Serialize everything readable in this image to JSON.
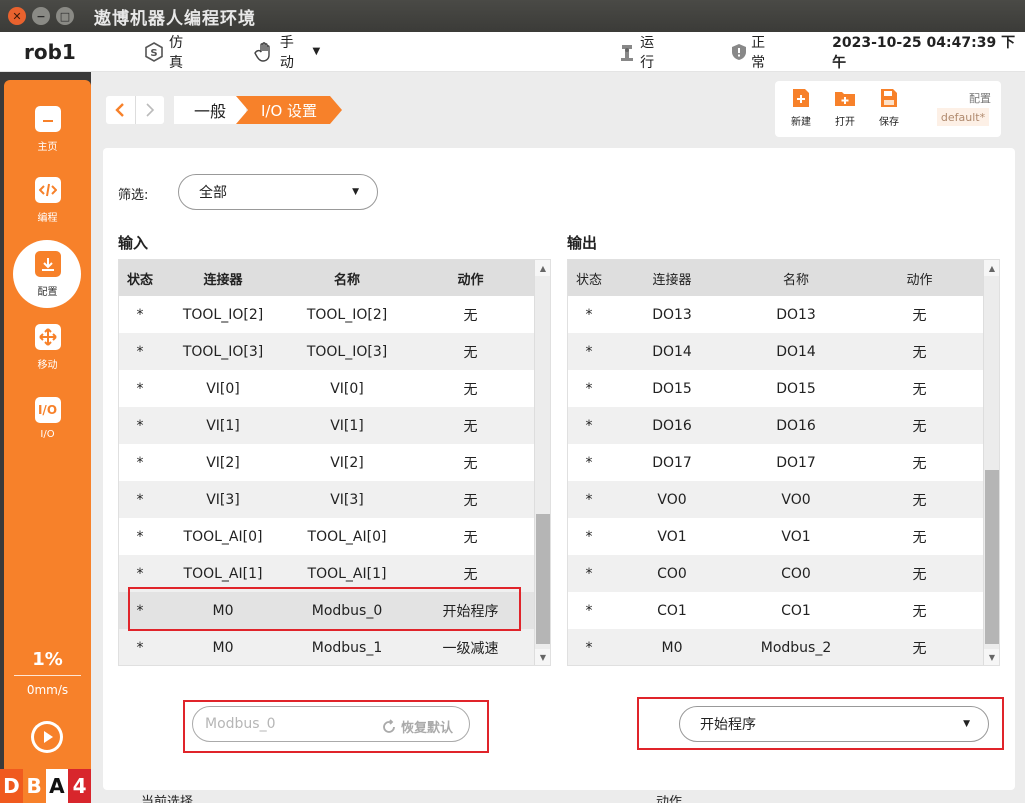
{
  "window": {
    "title": "遨博机器人编程环境"
  },
  "topbar": {
    "robot_name": "rob1",
    "sim_label": "仿真",
    "manual_label": "手动",
    "run_label": "运行",
    "status_label": "正常",
    "datetime": "2023-10-25 04:47:39 下午"
  },
  "sidebar": {
    "items": [
      {
        "label": "主页",
        "icon": "home-icon"
      },
      {
        "label": "编程",
        "icon": "code-icon"
      },
      {
        "label": "配置",
        "icon": "config-icon"
      },
      {
        "label": "移动",
        "icon": "move-icon"
      },
      {
        "label": "I/O",
        "icon": "io-icon",
        "glyph": "I/O"
      }
    ],
    "speed_percent": "1%",
    "speed_value": "0mm/s",
    "badges": [
      "D",
      "B",
      "A",
      "4"
    ]
  },
  "breadcrumb": {
    "level1": "一般",
    "level2": "I/O 设置"
  },
  "toolbar": {
    "new_label": "新建",
    "open_label": "打开",
    "save_label": "保存",
    "config_label": "配置",
    "config_value": "default*"
  },
  "filter": {
    "label": "筛选:",
    "value": "全部"
  },
  "input": {
    "title": "输入",
    "headers": [
      "状态",
      "连接器",
      "名称",
      "动作"
    ],
    "rows": [
      [
        "*",
        "TOOL_IO[2]",
        "TOOL_IO[2]",
        "无"
      ],
      [
        "*",
        "TOOL_IO[3]",
        "TOOL_IO[3]",
        "无"
      ],
      [
        "*",
        "VI[0]",
        "VI[0]",
        "无"
      ],
      [
        "*",
        "VI[1]",
        "VI[1]",
        "无"
      ],
      [
        "*",
        "VI[2]",
        "VI[2]",
        "无"
      ],
      [
        "*",
        "VI[3]",
        "VI[3]",
        "无"
      ],
      [
        "*",
        "TOOL_AI[0]",
        "TOOL_AI[0]",
        "无"
      ],
      [
        "*",
        "TOOL_AI[1]",
        "TOOL_AI[1]",
        "无"
      ],
      [
        "*",
        "M0",
        "Modbus_0",
        "开始程序"
      ],
      [
        "*",
        "M0",
        "Modbus_1",
        "一级减速"
      ]
    ]
  },
  "output": {
    "title": "输出",
    "headers": [
      "状态",
      "连接器",
      "名称",
      "动作"
    ],
    "rows": [
      [
        "*",
        "DO13",
        "DO13",
        "无"
      ],
      [
        "*",
        "DO14",
        "DO14",
        "无"
      ],
      [
        "*",
        "DO15",
        "DO15",
        "无"
      ],
      [
        "*",
        "DO16",
        "DO16",
        "无"
      ],
      [
        "*",
        "DO17",
        "DO17",
        "无"
      ],
      [
        "*",
        "VO0",
        "VO0",
        "无"
      ],
      [
        "*",
        "VO1",
        "VO1",
        "无"
      ],
      [
        "*",
        "CO0",
        "CO0",
        "无"
      ],
      [
        "*",
        "CO1",
        "CO1",
        "无"
      ],
      [
        "*",
        "M0",
        "Modbus_2",
        "无"
      ]
    ]
  },
  "current": {
    "label": "当前选择",
    "placeholder": "Modbus_0",
    "reset_label": "恢复默认"
  },
  "action": {
    "label": "动作",
    "value": "开始程序"
  },
  "colors": {
    "accent": "#f7812a",
    "highlight": "#e0242a"
  }
}
